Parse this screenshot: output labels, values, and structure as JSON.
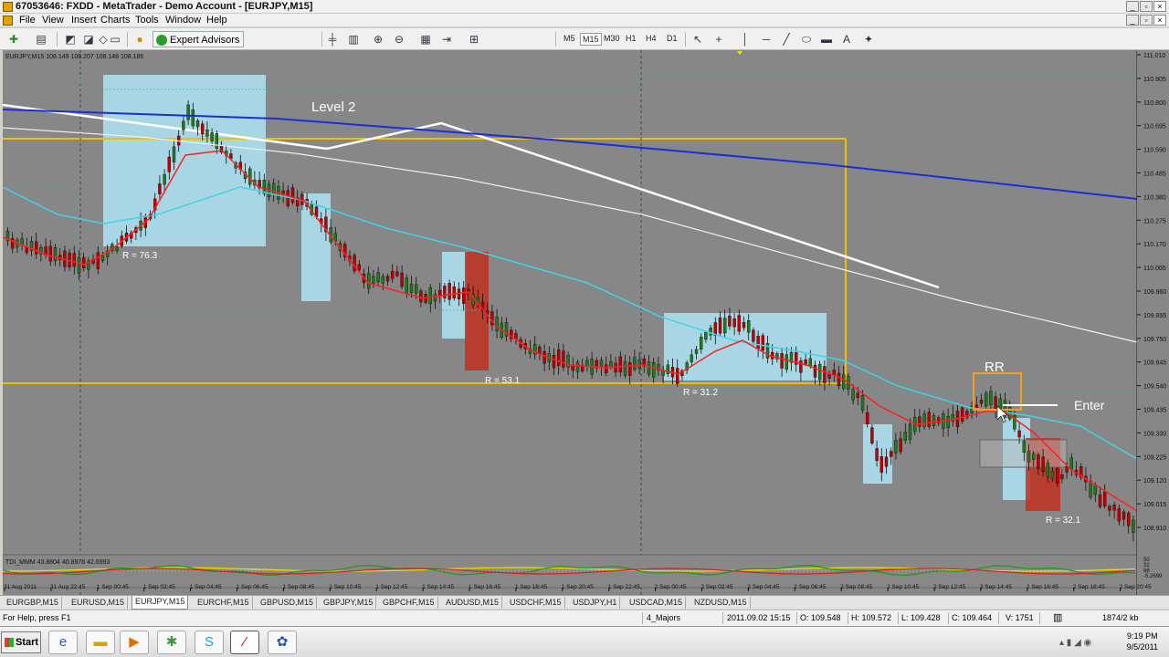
{
  "window": {
    "title": "67053646: FXDD - MetaTrader - Demo Account - [EURJPY,M15]"
  },
  "menu": [
    "File",
    "View",
    "Insert",
    "Charts",
    "Tools",
    "Window",
    "Help"
  ],
  "toolbar": {
    "expert_advisors": "Expert Advisors",
    "timeframes": [
      "M5",
      "M15",
      "M30",
      "H1",
      "H4",
      "D1"
    ],
    "active_timeframe": "M15"
  },
  "chart": {
    "header": "EURJPY,M15  108.149 108.207 108.148 108.186",
    "annotations": {
      "level2": "Level 2",
      "rr": "RR",
      "enter": "Enter",
      "r1": "R = 76.3",
      "r2": "R = 53.1",
      "r3": "R = 31.2",
      "r4": "R = 32.1"
    },
    "price_ticks": [
      "111.010",
      "110.905",
      "110.800",
      "110.695",
      "110.590",
      "110.485",
      "110.380",
      "110.275",
      "110.170",
      "110.065",
      "109.960",
      "109.855",
      "109.750",
      "109.645",
      "109.540",
      "109.435",
      "109.330",
      "109.225",
      "109.120",
      "109.015",
      "108.910"
    ],
    "time_ticks": [
      "31 Aug 2011",
      "31 Aug 22:45",
      "1 Sep 00:45",
      "1 Sep 02:45",
      "1 Sep 04:45",
      "1 Sep 06:45",
      "1 Sep 08:45",
      "1 Sep 10:45",
      "1 Sep 12:45",
      "1 Sep 14:45",
      "1 Sep 16:45",
      "1 Sep 18:45",
      "1 Sep 20:45",
      "1 Sep 22:45",
      "2 Sep 00:45",
      "2 Sep 02:45",
      "2 Sep 04:45",
      "2 Sep 06:45",
      "2 Sep 08:45",
      "2 Sep 10:45",
      "2 Sep 12:45",
      "2 Sep 14:45",
      "2 Sep 16:45",
      "2 Sep 18:45",
      "2 Sep 20:45"
    ],
    "indicator_header": "TDI_MMM 43.8804 40.8978 42.6993",
    "indicator_ticks": [
      "50",
      "32",
      "68",
      "-5.2699"
    ],
    "colors": {
      "background": "#878787",
      "bull": "#1e7a1e",
      "bear": "#c00000",
      "red_ma": "#ff2020",
      "cyan_ma": "#3fd4e6",
      "blue_ma": "#1c2ed8",
      "white_ma": "#f0f0f0",
      "level": "#f0c000",
      "zone_light": "#aee4f6",
      "zone_dark": "#c0311e"
    }
  },
  "tabs": [
    "EURGBP,M15",
    "EURUSD,M15",
    "EURJPY,M15",
    "EURCHF,M15",
    "GBPUSD,M15",
    "GBPJPY,M15",
    "GBPCHF,M15",
    "AUDUSD,M15",
    "USDCHF,M15",
    "USDJPY,H1",
    "USDCAD,M15",
    "NZDUSD,M15"
  ],
  "active_tab": "EURJPY,M15",
  "status": {
    "help": "For Help, press F1",
    "profile": "4_Majors",
    "datetime": "2011.09.02 15:15",
    "open": "O: 109.548",
    "high": "H: 109.572",
    "low": "L: 109.428",
    "close": "C: 109.464",
    "volume": "V: 1751",
    "traffic": "1874/2 kb"
  },
  "taskbar": {
    "start": "Start",
    "time": "9:19 PM",
    "date": "9/5/2011"
  }
}
